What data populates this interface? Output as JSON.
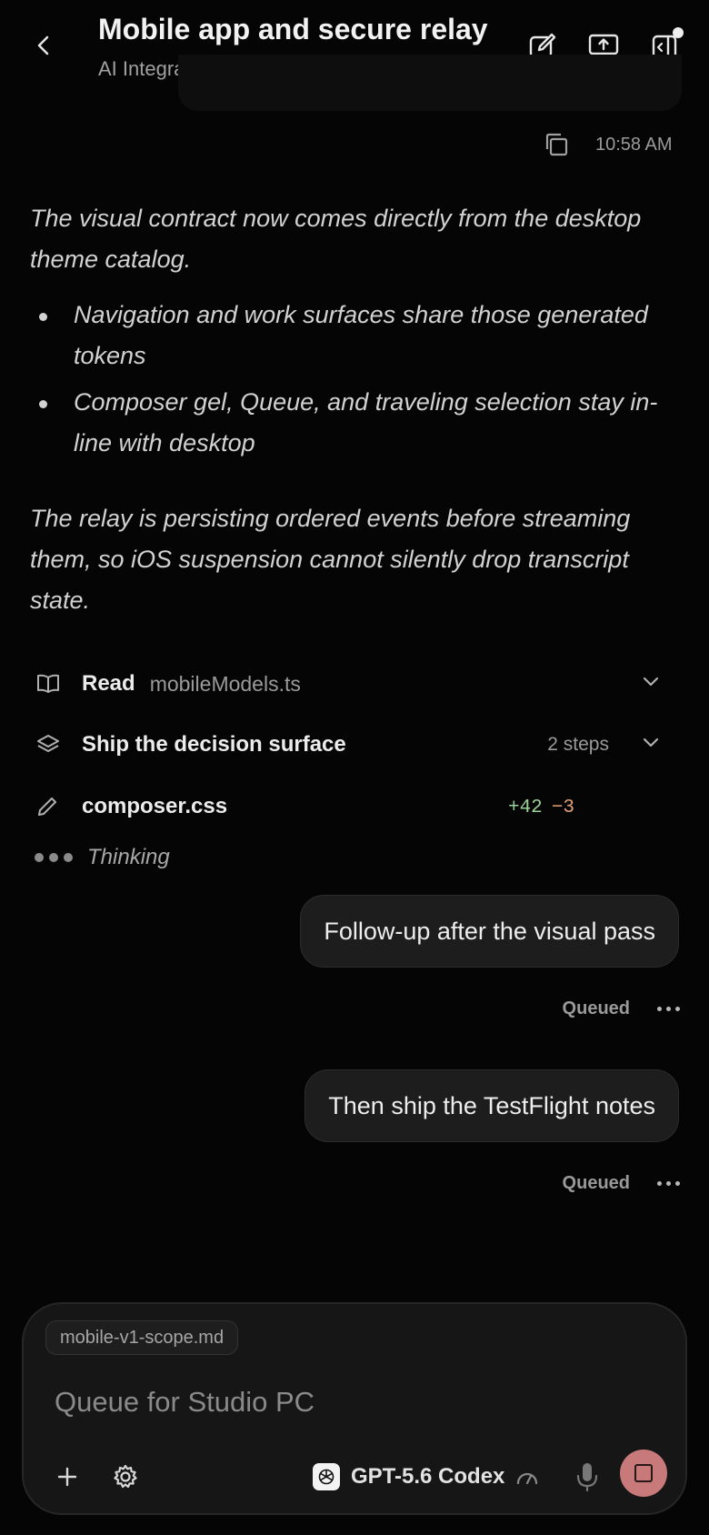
{
  "header": {
    "title": "Mobile app and secure relay",
    "subtitle": "AI Integrator"
  },
  "message_meta": {
    "time": "10:58 AM"
  },
  "assistant": {
    "para1": "The visual contract now comes directly from the desktop theme catalog.",
    "bullets": [
      "Navigation and work surfaces share those generated tokens",
      "Composer gel, Queue, and traveling selection stay in-line with desktop"
    ],
    "para2": "The relay is persisting ordered events before streaming them, so iOS suspension cannot silently drop transcript state."
  },
  "tools": {
    "read_label": "Read",
    "read_file": "mobileModels.ts",
    "plan_label": "Ship the decision surface",
    "plan_steps": "2 steps",
    "edit_file": "composer.css",
    "additions": "+42",
    "deletions": "−3"
  },
  "thinking_label": "Thinking",
  "queue": [
    {
      "text": "Follow-up after the visual pass",
      "status": "Queued"
    },
    {
      "text": "Then ship the TestFlight notes",
      "status": "Queued"
    }
  ],
  "composer": {
    "attachment": "mobile-v1-scope.md",
    "placeholder": "Queue for Studio PC",
    "model": "GPT-5.6 Codex",
    "stop_color": "#c87a7a"
  }
}
